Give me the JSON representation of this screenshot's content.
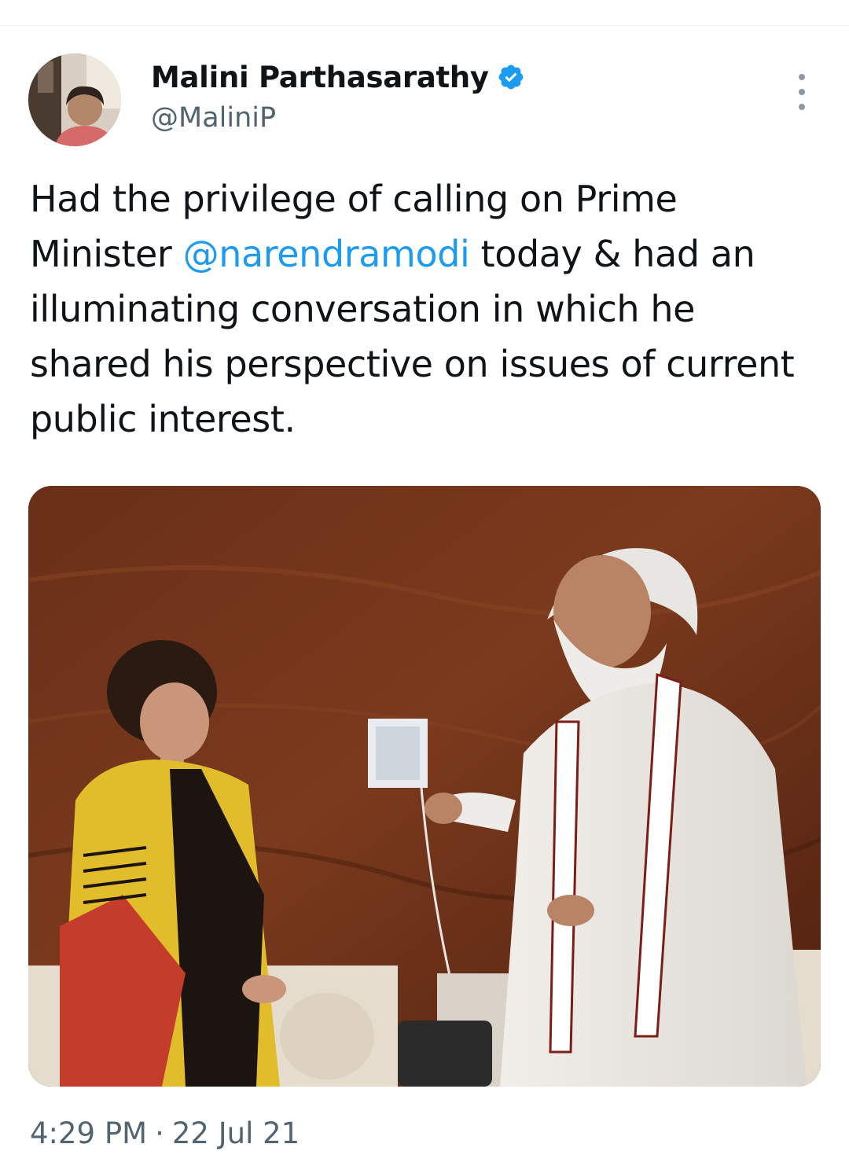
{
  "author": {
    "display_name": "Malini Parthasarathy",
    "handle": "@MaliniP",
    "verified_icon": "verified-badge-icon"
  },
  "tweet": {
    "text_before": "Had the privilege of calling on Prime Minister ",
    "mention": "@narendramodi",
    "text_after": " today & had an illuminating conversation in which he shared his perspective on issues of current public interest."
  },
  "meta": {
    "time": "4:29 PM",
    "separator": "·",
    "date": "22 Jul 21"
  },
  "icons": {
    "more": "more-options-icon"
  },
  "colors": {
    "link": "#1d9bf0",
    "text": "#0f1419",
    "secondary": "#536471",
    "verified": "#1d9bf0"
  }
}
